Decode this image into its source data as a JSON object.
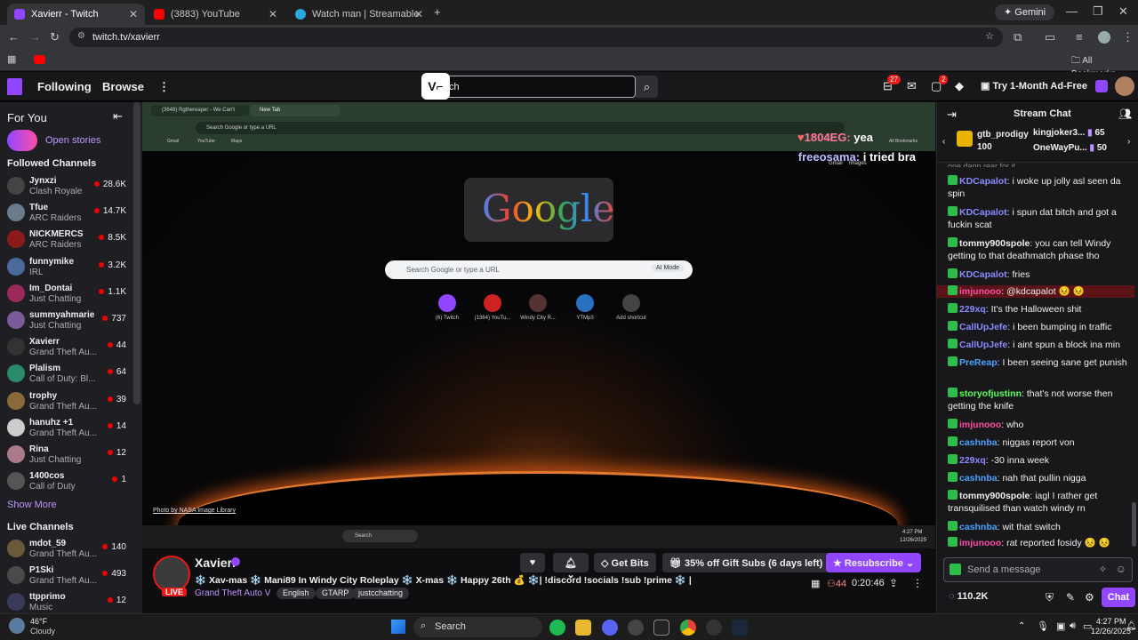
{
  "browser": {
    "tabs": [
      {
        "title": "Xavierr - Twitch",
        "active": true
      },
      {
        "title": "(3883) YouTube",
        "active": false
      },
      {
        "title": "Watch man | Streamable",
        "active": false
      }
    ],
    "gemini_label": "Gemini",
    "url": "twitch.tv/xavierr",
    "all_bookmarks": "All Bookmarks"
  },
  "twitch_nav": {
    "following": "Following",
    "browse": "Browse",
    "search_value": "ch",
    "inbox_badge": "27",
    "notif_badge": "2",
    "ad_free": "Try 1-Month Ad-Free"
  },
  "sidebar": {
    "for_you": "For You",
    "open_stories": "Open stories",
    "followed_title": "Followed Channels",
    "followed": [
      {
        "name": "Jynxzi",
        "game": "Clash Royale",
        "viewers": "28.6K",
        "color": "#444"
      },
      {
        "name": "Tfue",
        "game": "ARC Raiders",
        "viewers": "14.7K",
        "color": "#6b7b8c"
      },
      {
        "name": "NICKMERCS",
        "game": "ARC Raiders",
        "viewers": "8.5K",
        "color": "#8b1a1a"
      },
      {
        "name": "funnymike",
        "game": "IRL",
        "viewers": "3.2K",
        "color": "#4a6a9a"
      },
      {
        "name": "Im_Dontai",
        "game": "Just Chatting",
        "viewers": "1.1K",
        "color": "#9a2a5a"
      },
      {
        "name": "summyahmarie",
        "game": "Just Chatting",
        "viewers": "737",
        "color": "#7a5a9a"
      },
      {
        "name": "Xavierr",
        "game": "Grand Theft Au...",
        "viewers": "44",
        "color": "#333"
      },
      {
        "name": "Plalism",
        "game": "Call of Duty: Bl...",
        "viewers": "64",
        "color": "#2a8a6a"
      },
      {
        "name": "trophy",
        "game": "Grand Theft Au...",
        "viewers": "39",
        "color": "#8a6a3a"
      },
      {
        "name": "hanuhz +1",
        "game": "Grand Theft Au...",
        "viewers": "14",
        "color": "#ccc"
      },
      {
        "name": "Rina",
        "game": "Just Chatting",
        "viewers": "12",
        "color": "#aa7a8a"
      },
      {
        "name": "1400cos",
        "game": "Call of Duty",
        "viewers": "1",
        "color": "#555"
      }
    ],
    "show_more": "Show More",
    "live_title": "Live Channels",
    "live": [
      {
        "name": "mdot_59",
        "game": "Grand Theft Au...",
        "viewers": "140",
        "color": "#6a5a3a"
      },
      {
        "name": "P1Ski",
        "game": "Grand Theft Au...",
        "viewers": "493",
        "color": "#4a4a4a"
      },
      {
        "name": "ttpprimo",
        "game": "Music",
        "viewers": "12",
        "color": "#3a3a5a"
      }
    ]
  },
  "video": {
    "inner_tabs": [
      "(3648) Rgthereaper - We Can't",
      "New Tab"
    ],
    "inner_url": "Search Google or type a URL",
    "inner_bookmarks": [
      "Gmail",
      "YouTube",
      "Maps"
    ],
    "inner_all_bookmarks": "All Bookmarks",
    "google_logo": "Google",
    "gmail": "Gmail",
    "images": "Images",
    "search_placeholder": "Search Google or type a URL",
    "ai_mode": "AI Mode",
    "shortcuts": [
      "(6) Twitch",
      "(1364) YouTu...",
      "Windy City R...",
      "YTMp3",
      "Add shortcut"
    ],
    "overlay_line1_user": "1804EG:",
    "overlay_line1_text": "yea",
    "overlay_line2_user": "freeosama:",
    "overlay_line2_text": "i tried bra",
    "nasa_credit": "Photo by NASA Image Library",
    "inner_search": "Search",
    "inner_time": "4:27 PM",
    "inner_date": "12/26/2025"
  },
  "stream": {
    "streamer": "Xavierr",
    "live_label": "LIVE",
    "title": "❄️ Xav-mas ❄️ Mani89 In Windy City Roleplay ❄️ X-mas ❄️ Happy 26th 💰 ❄️| !discord !socials !sub !prime ❄️ | #XG ❄️",
    "game": "Grand Theft Auto V",
    "tags": [
      "English",
      "GTARP",
      "justcchatting"
    ],
    "get_bits": "Get Bits",
    "gift_subs": "35% off Gift Subs (6 days left)",
    "resubscribe": "Resubscribe",
    "viewers": "44",
    "uptime": "0:20:46"
  },
  "chat": {
    "title": "Stream Chat",
    "top_user": "gtb_prodigy",
    "top_count": "100",
    "leaders": [
      {
        "name": "kingjoker3...",
        "count": "65"
      },
      {
        "name": "OneWayPu...",
        "count": "50"
      }
    ],
    "partial": "one dann rear for it",
    "messages": [
      {
        "user": "KDCapalot",
        "color": "#8a8aff",
        "text": "i woke up jolly asl seen da spin"
      },
      {
        "user": "KDCapalot",
        "color": "#8a8aff",
        "text": "i spun dat bitch and got a fuckin scat"
      },
      {
        "user": "tommy900spole",
        "color": "#efeff1",
        "text": "you can tell Windy getting to that deathmatch phase tho"
      },
      {
        "user": "KDCapalot",
        "color": "#8a8aff",
        "text": "fries"
      },
      {
        "user": "imjunooo",
        "color": "#ff4da6",
        "text": "@kdcapalot 😣 😣"
      },
      {
        "user": "229xq",
        "color": "#8a8aff",
        "text": "It's the Halloween shit"
      },
      {
        "user": "CallUpJefe",
        "color": "#8a8aff",
        "text": "i been bumping in traffic"
      },
      {
        "user": "CallUpJefe",
        "color": "#8a8aff",
        "text": "i aint spun a block ina min"
      },
      {
        "user": "PreReap",
        "color": "#4aa3ff",
        "text": "I been seeing sane get punish"
      },
      {
        "user": "storyofjustinn",
        "color": "#5aff5a",
        "text": "that's not worse then getting the knife"
      },
      {
        "user": "imjunooo",
        "color": "#ff4da6",
        "text": "who"
      },
      {
        "user": "cashnba",
        "color": "#4aa3ff",
        "text": "niggas report von"
      },
      {
        "user": "229xq",
        "color": "#8a8aff",
        "text": "-30 inna week"
      },
      {
        "user": "cashnba",
        "color": "#4aa3ff",
        "text": "nah that pullin nigga"
      },
      {
        "user": "tommy900spole",
        "color": "#efeff1",
        "text": "iagl I rather get transquilised than watch windy rn"
      },
      {
        "user": "cashnba",
        "color": "#4aa3ff",
        "text": "wit that switch"
      },
      {
        "user": "imjunooo",
        "color": "#ff4da6",
        "text": "rat reported fosidy 😣 😣"
      }
    ],
    "placeholder": "Send a message",
    "points": "110.2K",
    "chat_button": "Chat"
  },
  "os": {
    "temp": "46°F",
    "weather": "Cloudy",
    "search": "Search",
    "time": "4:27 PM",
    "date": "12/26/2025"
  },
  "colors": {
    "twitch_purple": "#9147ff",
    "live_red": "#eb0400"
  }
}
